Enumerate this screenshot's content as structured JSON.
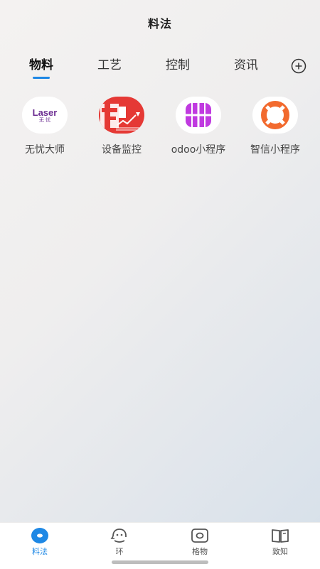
{
  "header": {
    "title": "料法"
  },
  "tabs": [
    {
      "label": "物料",
      "active": true
    },
    {
      "label": "工艺",
      "active": false
    },
    {
      "label": "控制",
      "active": false
    },
    {
      "label": "资讯",
      "active": false
    }
  ],
  "add_tab_icon": "plus-circle-icon",
  "apps": [
    {
      "label": "无忧大师",
      "logo_text": "Laser",
      "logo_sub": "无 忧",
      "icon": "laser-logo-icon"
    },
    {
      "label": "设备监控",
      "icon": "equipment-monitor-icon"
    },
    {
      "label": "odoo小程序",
      "icon": "grid-apps-icon"
    },
    {
      "label": "智信小程序",
      "icon": "lifebuoy-icon"
    }
  ],
  "bottom_nav": [
    {
      "label": "料法",
      "icon": "eye-dot-icon",
      "active": true
    },
    {
      "label": "环",
      "icon": "face-icon",
      "active": false
    },
    {
      "label": "格物",
      "icon": "camera-icon",
      "active": false
    },
    {
      "label": "致知",
      "icon": "book-icon",
      "active": false
    }
  ],
  "colors": {
    "accent": "#1e88e5",
    "laser_purple": "#6b2c91",
    "monitor_red": "#e53935",
    "grid_purple": "#c03ae0",
    "buoy_orange": "#f26a2e"
  }
}
